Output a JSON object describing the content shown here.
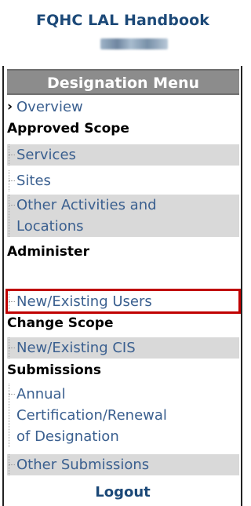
{
  "header": {
    "title": "FQHC LAL Handbook",
    "user_id": "LAL000000"
  },
  "menu": {
    "heading": "Designation Menu",
    "overview": "Overview",
    "sections": {
      "approved_scope": {
        "label": "Approved Scope",
        "items": [
          "Services",
          "Sites",
          "Other Activities and",
          "Locations"
        ]
      },
      "administer": {
        "label": "Administer",
        "items": [
          "New/Existing Users"
        ]
      },
      "change_scope": {
        "label": "Change Scope",
        "items": [
          "New/Existing CIS"
        ]
      },
      "submissions": {
        "label": "Submissions",
        "items": [
          "Annual",
          "Certification/Renewal",
          "of Designation",
          "Other Submissions"
        ]
      }
    }
  },
  "footer": {
    "logout": "Logout"
  },
  "colors": {
    "title": "#1c4978",
    "link": "#3a5f8f",
    "menu_header_bg": "#8c8c8c",
    "highlight": "#c00000"
  }
}
